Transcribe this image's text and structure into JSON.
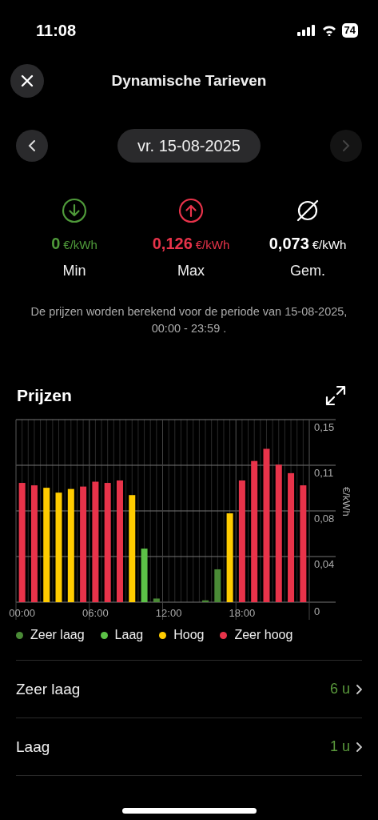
{
  "status_bar": {
    "time": "11:08",
    "battery": "74"
  },
  "header": {
    "title": "Dynamische Tarieven"
  },
  "date_nav": {
    "date": "vr. 15-08-2025",
    "prev": {
      "disabled": false
    },
    "next": {
      "disabled": true
    }
  },
  "stats": [
    {
      "kind": "min",
      "value": "0",
      "unit": "€/kWh",
      "label": "Min"
    },
    {
      "kind": "max",
      "value": "0,126",
      "unit": "€/kWh",
      "label": "Max"
    },
    {
      "kind": "avg",
      "value": "0,073",
      "unit": "€/kWh",
      "label": "Gem."
    }
  ],
  "note": "De prijzen worden berekend voor de periode van 15-08-2025, 00:00 - 23:59  .",
  "prices": {
    "title": "Prijzen",
    "chart_data": {
      "type": "bar",
      "ylabel": "€/kWh",
      "grid": true,
      "x": [
        0,
        1,
        2,
        3,
        4,
        5,
        6,
        7,
        8,
        9,
        10,
        11,
        12,
        13,
        14,
        15,
        16,
        17,
        18,
        19,
        20,
        21,
        22,
        23
      ],
      "series": [
        {
          "name": "Zeer laag",
          "color": "#4a8a36",
          "values": [
            null,
            null,
            null,
            null,
            null,
            null,
            null,
            null,
            null,
            null,
            null,
            0.003,
            null,
            null,
            null,
            0.0015,
            0.027,
            null,
            null,
            null,
            null,
            null,
            null,
            null
          ]
        },
        {
          "name": "Laag",
          "color": "#5cc247",
          "values": [
            null,
            null,
            null,
            null,
            null,
            null,
            null,
            null,
            null,
            null,
            0.044,
            null,
            null,
            null,
            null,
            null,
            null,
            null,
            null,
            null,
            null,
            null,
            null,
            null
          ]
        },
        {
          "name": "Hoog",
          "color": "#ffcc00",
          "values": [
            null,
            null,
            0.094,
            0.09,
            0.093,
            null,
            null,
            null,
            null,
            0.088,
            null,
            null,
            null,
            null,
            null,
            null,
            null,
            0.073,
            null,
            null,
            null,
            null,
            null,
            null
          ]
        },
        {
          "name": "Zeer hoog",
          "color": "#e8334a",
          "values": [
            0.098,
            0.096,
            null,
            null,
            null,
            0.095,
            0.099,
            0.098,
            0.1,
            null,
            null,
            null,
            null,
            null,
            null,
            null,
            null,
            null,
            0.1,
            0.116,
            0.126,
            0.113,
            0.106,
            0.096
          ]
        }
      ],
      "xlim": [
        -0.5,
        23.5
      ],
      "ylim": [
        0,
        0.15
      ],
      "xticks": [
        {
          "value": 0,
          "label": "00:00"
        },
        {
          "value": 6,
          "label": "06:00"
        },
        {
          "value": 12,
          "label": "12:00"
        },
        {
          "value": 18,
          "label": "18:00"
        }
      ],
      "yticks": [
        {
          "value": 0,
          "label": "0"
        },
        {
          "value": 0.0375,
          "label": "0,04"
        },
        {
          "value": 0.075,
          "label": "0,08"
        },
        {
          "value": 0.1125,
          "label": "0,11"
        },
        {
          "value": 0.15,
          "label": "0,15"
        }
      ]
    }
  },
  "levels": [
    {
      "label": "Zeer laag",
      "value": "6 u"
    },
    {
      "label": "Laag",
      "value": "1 u"
    }
  ]
}
